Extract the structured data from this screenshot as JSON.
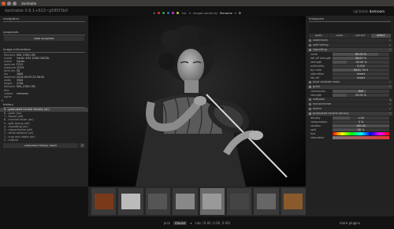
{
  "window": {
    "title": "darktable"
  },
  "header": {
    "version": "darktable 0.6.1+922~g585f3b0",
    "modes": [
      "lighttable",
      "darkroom",
      "map"
    ],
    "active_mode": "darkroom"
  },
  "topbar": {
    "filter_label": "1st.",
    "sort_label": "images sorted by",
    "sort_value": "filename",
    "color_labels": [
      "#d33",
      "#3a3",
      "#36c",
      "#c3c",
      "#cc3"
    ]
  },
  "left": {
    "navigation_title": "navigation",
    "snapshots_title": "snapshots",
    "take_snapshot": "take snapshot",
    "metadata_title": "image information",
    "metadata": [
      [
        "filename",
        "IMG_5785.CR2"
      ],
      [
        "model",
        "Canon EOS 350D DIGITAL"
      ],
      [
        "maker",
        "Canon"
      ],
      [
        "aperture",
        "F/3.5"
      ],
      [
        "exposure",
        "1/125"
      ],
      [
        "focal len.",
        "50"
      ],
      [
        "iso",
        "1600"
      ],
      [
        "datetime",
        "2010:09:29 22:36:20"
      ],
      [
        "width",
        "3504"
      ],
      [
        "height",
        "2336"
      ],
      [
        "filename",
        "IMG_5785.CR2"
      ],
      [
        "title",
        ""
      ],
      [
        "creator",
        "unknown"
      ],
      [
        "rights",
        ""
      ]
    ],
    "history_title": "history",
    "history": [
      "9 - graduated neutral density (on)",
      "8 - grain (on)",
      "7 - bloom (off)",
      "6 - channel mixer (on)",
      "5 - split toning (off)",
      "4 - vignetting (on)",
      "3 - monochrome (off)",
      "2 - white balance (on)",
      "1 - crop and rotate (on)",
      "0 - original"
    ],
    "compress_label": "compress history stack",
    "history_active": 0
  },
  "right": {
    "histogram_title": "histogram",
    "tabs": [
      "basic",
      "color",
      "correct",
      "effect"
    ],
    "active_tab": 3,
    "modules": [
      {
        "name": "watermark",
        "on": false
      },
      {
        "name": "split toning",
        "on": false
      }
    ],
    "vignetting": {
      "name": "vignetting",
      "sliders": [
        {
          "label": "scale",
          "value": "80.00 %",
          "fill": 0.8
        },
        {
          "label": "fall-off strength",
          "value": "50.00 %",
          "fill": 0.5
        },
        {
          "label": "strength",
          "value": "-50.00 %",
          "fill": 0.25
        },
        {
          "label": "uniformity",
          "value": "0.000",
          "fill": 0.0
        },
        {
          "label": "b/s ratio",
          "value": "50.0 / 50.0",
          "fill": 0.5
        },
        {
          "label": "saturation",
          "value": "invert",
          "fill": 0.0
        },
        {
          "label": "fall-off",
          "value": "invert",
          "fill": 0.0
        }
      ]
    },
    "local_contrast": "local contrast mask",
    "grain": {
      "name": "grain",
      "sliders": [
        {
          "label": "coarseness",
          "value": "800",
          "fill": 0.6
        },
        {
          "label": "strength",
          "value": "25.00 %",
          "fill": 0.25
        }
      ]
    },
    "more_modules": [
      {
        "name": "softglow",
        "on": false
      },
      {
        "name": "monochrome",
        "on": false
      },
      {
        "name": "bloom",
        "on": false
      }
    ],
    "gnd": {
      "name": "graduated neutral density",
      "sliders": [
        {
          "label": "density",
          "value": "1.00",
          "fill": 0.3
        },
        {
          "label": "compression",
          "value": "0 %",
          "fill": 0.0
        },
        {
          "label": "rotation",
          "value": "180.00",
          "fill": 1.0
        },
        {
          "label": "split",
          "value": "50 %",
          "fill": 0.5
        },
        {
          "label": "hue",
          "value": "",
          "fill": 0.0
        },
        {
          "label": "saturation",
          "value": "",
          "fill": 0.0
        }
      ]
    },
    "more_plugins": "more plugins"
  },
  "filmstrip": {
    "count": 8,
    "selected": 4
  },
  "bottom": {
    "pick_label": "pick",
    "mode_label": "mouse",
    "lab_readout": "Lab: (0.00, 0.00, 0.00)"
  }
}
